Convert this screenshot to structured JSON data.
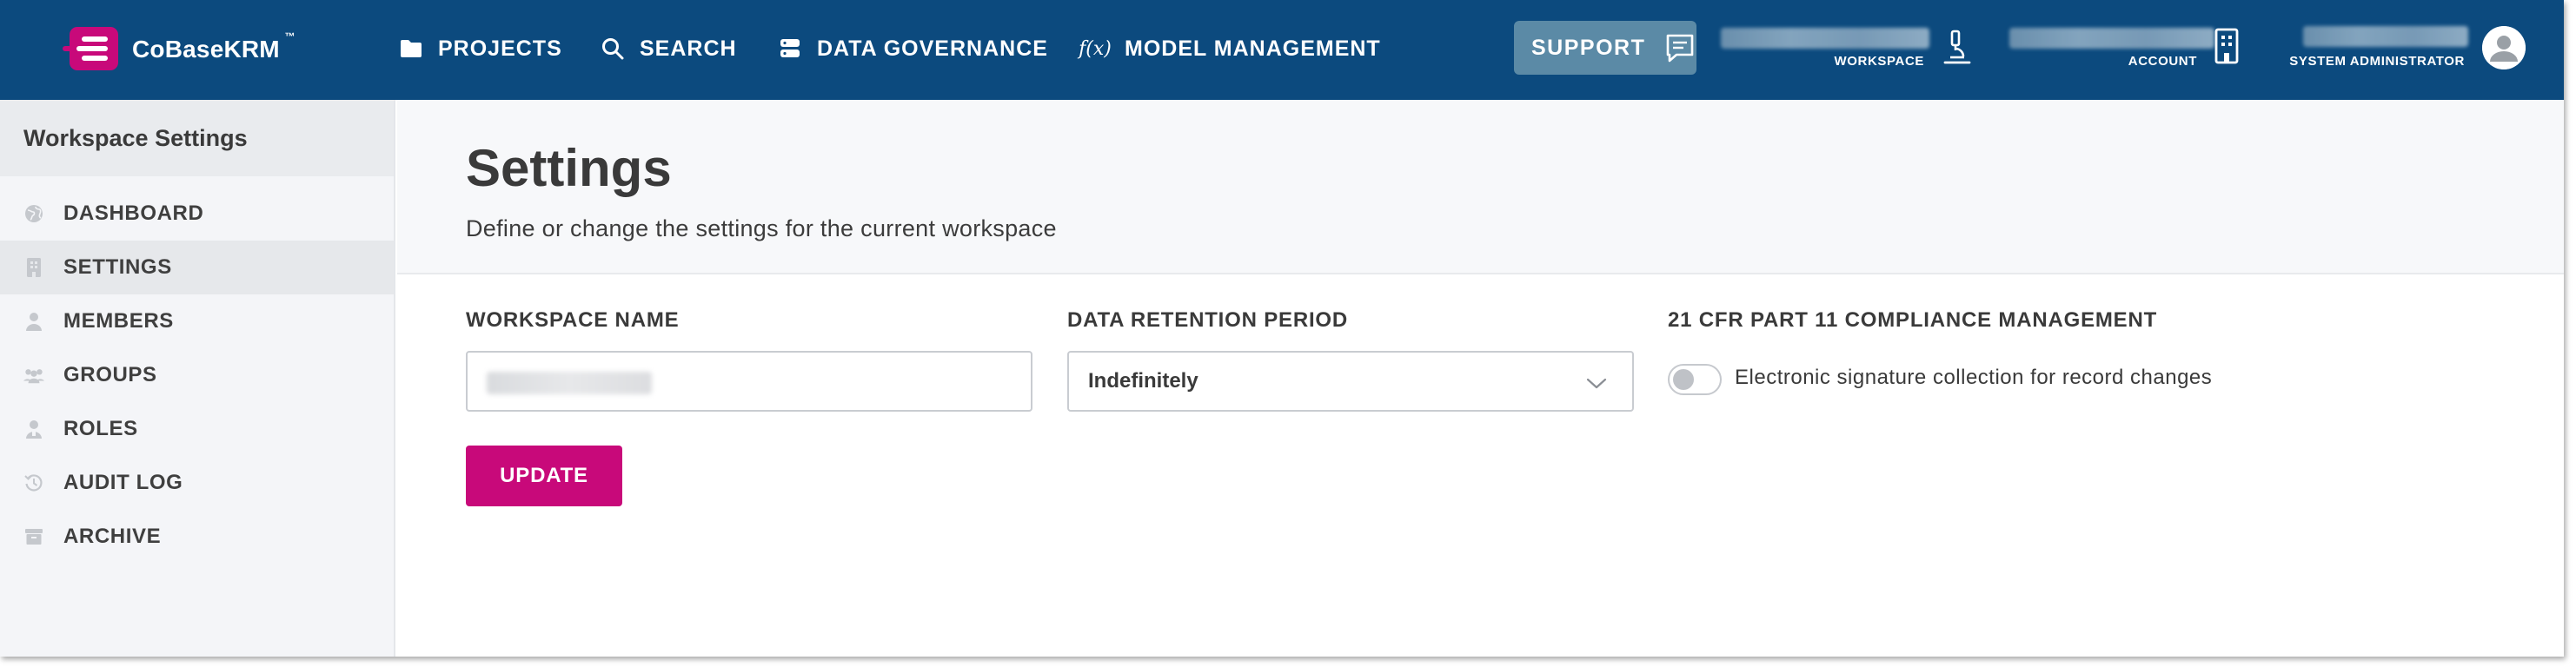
{
  "brand": {
    "name": "CoBaseKRM",
    "tm": "™",
    "logo_color": "#c8097a"
  },
  "nav": {
    "projects": {
      "label": "PROJECTS",
      "icon": "folder-icon"
    },
    "search": {
      "label": "SEARCH",
      "icon": "search-icon"
    },
    "governance": {
      "label": "DATA GOVERNANCE",
      "icon": "database-icon"
    },
    "model": {
      "label": "MODEL MANAGEMENT",
      "icon": "function-icon",
      "icon_glyph": "f(x)"
    }
  },
  "support": {
    "label": "SUPPORT",
    "icon": "chat-icon"
  },
  "header_right": {
    "workspace_caption": "WORKSPACE",
    "workspace_icon": "microscope-icon",
    "account_caption": "ACCOUNT",
    "account_icon": "building-icon",
    "user_caption": "SYSTEM ADMINISTRATOR",
    "avatar_icon": "user-avatar-icon"
  },
  "sidebar": {
    "title": "Workspace Settings",
    "items": [
      {
        "label": "DASHBOARD",
        "icon": "globe-icon",
        "active": false
      },
      {
        "label": "SETTINGS",
        "icon": "building-icon",
        "active": true
      },
      {
        "label": "MEMBERS",
        "icon": "person-icon",
        "active": false
      },
      {
        "label": "GROUPS",
        "icon": "people-icon",
        "active": false
      },
      {
        "label": "ROLES",
        "icon": "person-badge-icon",
        "active": false
      },
      {
        "label": "AUDIT LOG",
        "icon": "history-icon",
        "active": false
      },
      {
        "label": "ARCHIVE",
        "icon": "archive-icon",
        "active": false
      }
    ]
  },
  "page": {
    "title": "Settings",
    "subtitle": "Define or change the settings for the current workspace"
  },
  "form": {
    "workspace_name_label": "WORKSPACE NAME",
    "retention_label": "DATA RETENTION PERIOD",
    "retention_value": "Indefinitely",
    "compliance_label": "21 CFR PART 11 COMPLIANCE MANAGEMENT",
    "toggle_label": "Electronic signature collection for record changes",
    "toggle_on": false,
    "update_label": "UPDATE"
  },
  "colors": {
    "topbar": "#0c4a7e",
    "support_button": "#5b8aa6",
    "primary_button": "#c8097a",
    "sidebar_bg": "#f4f5f8"
  }
}
